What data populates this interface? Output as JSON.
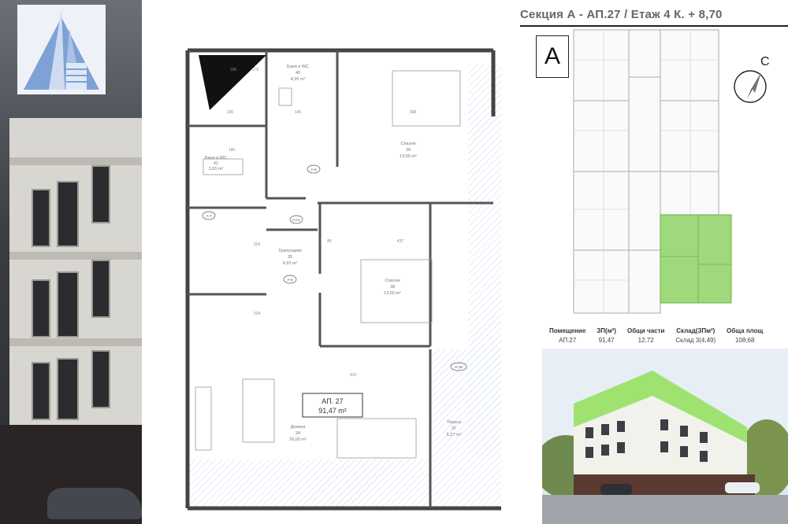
{
  "header": {
    "title": "Секция А - АП.27 / Етаж 4 К. + 8,70"
  },
  "section_label": "A",
  "compass_label": "C",
  "plan": {
    "rooms": [
      {
        "name": "Баня и WC",
        "code": "40",
        "area": "4,26 m²"
      },
      {
        "name": "Баня и WC",
        "code": "41",
        "area": "3,65 m²"
      },
      {
        "name": "Спалня",
        "code": "39",
        "area": "13,56 m²"
      },
      {
        "name": "Спалня",
        "code": "38",
        "area": "13,50 m²"
      },
      {
        "name": "Трапезария",
        "code": "35",
        "area": "9,93 m²"
      },
      {
        "name": "Дневна",
        "code": "34",
        "area": "26,00 m²"
      },
      {
        "name": "Тераса",
        "code": "37",
        "area": "5,27 m²"
      }
    ],
    "apartment_label": "АП. 27",
    "apartment_area": "91,47 m²",
    "doors": [
      "A-5",
      "A-7",
      "A-C1",
      "A-6",
      "A-15"
    ],
    "dims": [
      "190",
      "179",
      "190",
      "140",
      "368",
      "324",
      "85",
      "437",
      "324",
      "415",
      "190"
    ]
  },
  "summary_table": {
    "headers": [
      "Помещение",
      "ЗП(м²)",
      "Общи части",
      "Склад(ЗПм²)",
      "Обща площ"
    ],
    "row": [
      "АП.27",
      "91,47",
      "12,72",
      "Склад 3(4,49)",
      "108,68"
    ]
  },
  "colors": {
    "highlight": "#9fd97c",
    "logo": "#6f93c9",
    "wall": "#555555",
    "render_green": "#8ee05a"
  }
}
